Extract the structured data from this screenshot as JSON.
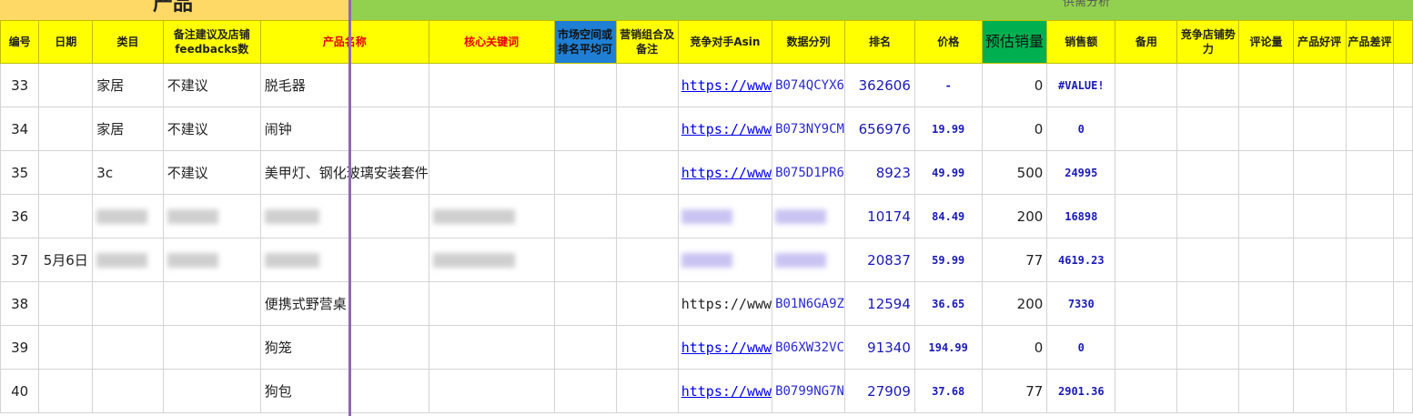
{
  "banner": {
    "left_title": "产品",
    "right_title": "供需分析"
  },
  "headers": [
    "编号",
    "日期",
    "类目",
    "备注建议及店铺feedbacks数",
    "产品名称",
    "核心关键词",
    "市场空间或排名平均可",
    "营销组合及备注",
    "竞争对手Asin",
    "数据分列",
    "排名",
    "价格",
    "预估销量",
    "销售额",
    "备用",
    "竞争店铺势力",
    "评论量",
    "产品好评",
    "产品差评",
    ""
  ],
  "rows": [
    {
      "no": "33",
      "date": "",
      "category": "家居",
      "note": "不建议",
      "product": "脱毛器",
      "link": "https://www",
      "asin": "B074QCYX6",
      "rank": "362606",
      "price": "-",
      "est": "0",
      "sales": "#VALUE!"
    },
    {
      "no": "34",
      "date": "",
      "category": "家居",
      "note": "不建议",
      "product": "闹钟",
      "link": "https://www",
      "asin": "B073NY9CM",
      "rank": "656976",
      "price": "19.99",
      "est": "0",
      "sales": "0"
    },
    {
      "no": "35",
      "date": "",
      "category": "3c",
      "note": "不建议",
      "product": "美甲灯、钢化玻璃安装套件",
      "link": "https://www",
      "asin": "B075D1PR6",
      "rank": "8923",
      "price": "49.99",
      "est": "500",
      "sales": "24995"
    },
    {
      "no": "36",
      "date": "",
      "category": "",
      "note": "",
      "product": "",
      "link": "",
      "asin": "",
      "rank": "10174",
      "price": "84.49",
      "est": "200",
      "sales": "16898"
    },
    {
      "no": "37",
      "date": "5月6日",
      "category": "",
      "note": "",
      "product": "",
      "link": "",
      "asin": "",
      "rank": "20837",
      "price": "59.99",
      "est": "77",
      "sales": "4619.23"
    },
    {
      "no": "38",
      "date": "",
      "category": "",
      "note": "",
      "product": "便携式野营桌",
      "link": "https://www",
      "asin": "B01N6GA9Z",
      "rank": "12594",
      "price": "36.65",
      "est": "200",
      "sales": "7330"
    },
    {
      "no": "39",
      "date": "",
      "category": "",
      "note": "",
      "product": "狗笼",
      "link": "https://www",
      "asin": "B06XW32VC",
      "rank": "91340",
      "price": "194.99",
      "est": "0",
      "sales": "0"
    },
    {
      "no": "40",
      "date": "",
      "category": "",
      "note": "",
      "product": "狗包",
      "link": "https://www",
      "asin": "B0799NG7N",
      "rank": "27909",
      "price": "37.68",
      "est": "77",
      "sales": "2901.36"
    }
  ]
}
